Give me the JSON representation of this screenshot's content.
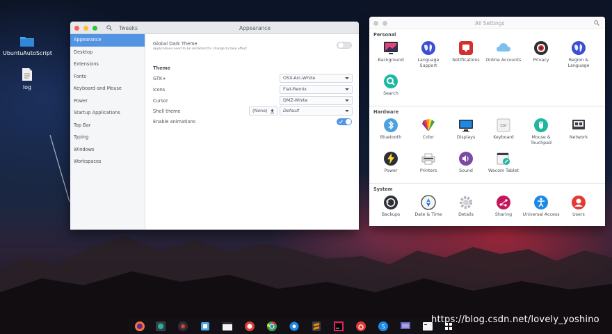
{
  "desktop": {
    "icons": [
      {
        "label": "UbuntuAutoScript",
        "icon": "folder-icon"
      },
      {
        "label": "log",
        "icon": "text-file-icon"
      }
    ]
  },
  "tweaks": {
    "app_title": "Tweaks",
    "page_title": "Appearance",
    "sidebar": [
      "Appearance",
      "Desktop",
      "Extensions",
      "Fonts",
      "Keyboard and Mouse",
      "Power",
      "Startup Applications",
      "Top Bar",
      "Typing",
      "Windows",
      "Workspaces"
    ],
    "global_dark_theme": {
      "label": "Global Dark Theme",
      "note": "Applications need to be restarted for change to take effect",
      "enabled": false
    },
    "theme_heading": "Theme",
    "gtk": {
      "label": "GTK+",
      "value": "OSX-Arc-White"
    },
    "icons": {
      "label": "Icons",
      "value": "Flat-Remix"
    },
    "cursor": {
      "label": "Cursor",
      "value": "DMZ-White"
    },
    "shell_theme": {
      "label": "Shell theme",
      "none_label": "(None)",
      "value": "Default"
    },
    "enable_animations": {
      "label": "Enable animations",
      "enabled": true
    }
  },
  "settings": {
    "title": "All Settings",
    "sections": [
      {
        "name": "Personal",
        "items": [
          {
            "label": "Background",
            "icon": "background-icon"
          },
          {
            "label": "Language Support",
            "icon": "language-support-icon"
          },
          {
            "label": "Notifications",
            "icon": "notifications-icon"
          },
          {
            "label": "Online Accounts",
            "icon": "online-accounts-icon"
          },
          {
            "label": "Privacy",
            "icon": "privacy-icon"
          },
          {
            "label": "Region & Language",
            "icon": "region-language-icon"
          },
          {
            "label": "Search",
            "icon": "search-icon"
          }
        ]
      },
      {
        "name": "Hardware",
        "items": [
          {
            "label": "Bluetooth",
            "icon": "bluetooth-icon"
          },
          {
            "label": "Color",
            "icon": "color-icon"
          },
          {
            "label": "Displays",
            "icon": "displays-icon"
          },
          {
            "label": "Keyboard",
            "icon": "keyboard-icon"
          },
          {
            "label": "Mouse & Touchpad",
            "icon": "mouse-touchpad-icon"
          },
          {
            "label": "Network",
            "icon": "network-icon"
          },
          {
            "label": "Power",
            "icon": "power-icon"
          },
          {
            "label": "Printers",
            "icon": "printers-icon"
          },
          {
            "label": "Sound",
            "icon": "sound-icon"
          },
          {
            "label": "Wacom Tablet",
            "icon": "wacom-tablet-icon"
          }
        ]
      },
      {
        "name": "System",
        "items": [
          {
            "label": "Backups",
            "icon": "backups-icon"
          },
          {
            "label": "Date & Time",
            "icon": "date-time-icon"
          },
          {
            "label": "Details",
            "icon": "details-icon"
          },
          {
            "label": "Sharing",
            "icon": "sharing-icon"
          },
          {
            "label": "Universal Access",
            "icon": "universal-access-icon"
          },
          {
            "label": "Users",
            "icon": "users-icon"
          }
        ]
      }
    ]
  },
  "dock": [
    "firefox-icon",
    "disk-icon",
    "recorder-icon",
    "files-blue-icon",
    "window-icon",
    "help-icon",
    "chrome-icon",
    "settings-gear-icon",
    "sublime-icon",
    "intellij-icon",
    "netease-music-icon",
    "skype-icon",
    "screenshot-icon",
    "terminal-icon",
    "show-apps-icon"
  ],
  "watermark": "https://blog.csdn.net/lovely_yoshino",
  "colors": {
    "accent": "#5294e2",
    "sidebar_bg": "#f5f6f7",
    "titlebar": "#e7e8eb"
  }
}
